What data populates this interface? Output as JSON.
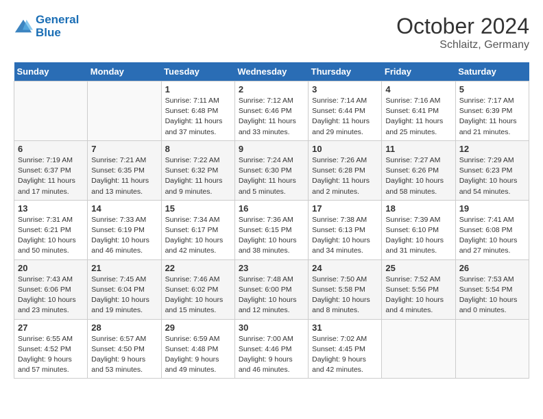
{
  "header": {
    "logo_line1": "General",
    "logo_line2": "Blue",
    "month_title": "October 2024",
    "location": "Schlaitz, Germany"
  },
  "days_of_week": [
    "Sunday",
    "Monday",
    "Tuesday",
    "Wednesday",
    "Thursday",
    "Friday",
    "Saturday"
  ],
  "weeks": [
    [
      {
        "day": "",
        "info": ""
      },
      {
        "day": "",
        "info": ""
      },
      {
        "day": "1",
        "info": "Sunrise: 7:11 AM\nSunset: 6:48 PM\nDaylight: 11 hours\nand 37 minutes."
      },
      {
        "day": "2",
        "info": "Sunrise: 7:12 AM\nSunset: 6:46 PM\nDaylight: 11 hours\nand 33 minutes."
      },
      {
        "day": "3",
        "info": "Sunrise: 7:14 AM\nSunset: 6:44 PM\nDaylight: 11 hours\nand 29 minutes."
      },
      {
        "day": "4",
        "info": "Sunrise: 7:16 AM\nSunset: 6:41 PM\nDaylight: 11 hours\nand 25 minutes."
      },
      {
        "day": "5",
        "info": "Sunrise: 7:17 AM\nSunset: 6:39 PM\nDaylight: 11 hours\nand 21 minutes."
      }
    ],
    [
      {
        "day": "6",
        "info": "Sunrise: 7:19 AM\nSunset: 6:37 PM\nDaylight: 11 hours\nand 17 minutes."
      },
      {
        "day": "7",
        "info": "Sunrise: 7:21 AM\nSunset: 6:35 PM\nDaylight: 11 hours\nand 13 minutes."
      },
      {
        "day": "8",
        "info": "Sunrise: 7:22 AM\nSunset: 6:32 PM\nDaylight: 11 hours\nand 9 minutes."
      },
      {
        "day": "9",
        "info": "Sunrise: 7:24 AM\nSunset: 6:30 PM\nDaylight: 11 hours\nand 5 minutes."
      },
      {
        "day": "10",
        "info": "Sunrise: 7:26 AM\nSunset: 6:28 PM\nDaylight: 11 hours\nand 2 minutes."
      },
      {
        "day": "11",
        "info": "Sunrise: 7:27 AM\nSunset: 6:26 PM\nDaylight: 10 hours\nand 58 minutes."
      },
      {
        "day": "12",
        "info": "Sunrise: 7:29 AM\nSunset: 6:23 PM\nDaylight: 10 hours\nand 54 minutes."
      }
    ],
    [
      {
        "day": "13",
        "info": "Sunrise: 7:31 AM\nSunset: 6:21 PM\nDaylight: 10 hours\nand 50 minutes."
      },
      {
        "day": "14",
        "info": "Sunrise: 7:33 AM\nSunset: 6:19 PM\nDaylight: 10 hours\nand 46 minutes."
      },
      {
        "day": "15",
        "info": "Sunrise: 7:34 AM\nSunset: 6:17 PM\nDaylight: 10 hours\nand 42 minutes."
      },
      {
        "day": "16",
        "info": "Sunrise: 7:36 AM\nSunset: 6:15 PM\nDaylight: 10 hours\nand 38 minutes."
      },
      {
        "day": "17",
        "info": "Sunrise: 7:38 AM\nSunset: 6:13 PM\nDaylight: 10 hours\nand 34 minutes."
      },
      {
        "day": "18",
        "info": "Sunrise: 7:39 AM\nSunset: 6:10 PM\nDaylight: 10 hours\nand 31 minutes."
      },
      {
        "day": "19",
        "info": "Sunrise: 7:41 AM\nSunset: 6:08 PM\nDaylight: 10 hours\nand 27 minutes."
      }
    ],
    [
      {
        "day": "20",
        "info": "Sunrise: 7:43 AM\nSunset: 6:06 PM\nDaylight: 10 hours\nand 23 minutes."
      },
      {
        "day": "21",
        "info": "Sunrise: 7:45 AM\nSunset: 6:04 PM\nDaylight: 10 hours\nand 19 minutes."
      },
      {
        "day": "22",
        "info": "Sunrise: 7:46 AM\nSunset: 6:02 PM\nDaylight: 10 hours\nand 15 minutes."
      },
      {
        "day": "23",
        "info": "Sunrise: 7:48 AM\nSunset: 6:00 PM\nDaylight: 10 hours\nand 12 minutes."
      },
      {
        "day": "24",
        "info": "Sunrise: 7:50 AM\nSunset: 5:58 PM\nDaylight: 10 hours\nand 8 minutes."
      },
      {
        "day": "25",
        "info": "Sunrise: 7:52 AM\nSunset: 5:56 PM\nDaylight: 10 hours\nand 4 minutes."
      },
      {
        "day": "26",
        "info": "Sunrise: 7:53 AM\nSunset: 5:54 PM\nDaylight: 10 hours\nand 0 minutes."
      }
    ],
    [
      {
        "day": "27",
        "info": "Sunrise: 6:55 AM\nSunset: 4:52 PM\nDaylight: 9 hours\nand 57 minutes."
      },
      {
        "day": "28",
        "info": "Sunrise: 6:57 AM\nSunset: 4:50 PM\nDaylight: 9 hours\nand 53 minutes."
      },
      {
        "day": "29",
        "info": "Sunrise: 6:59 AM\nSunset: 4:48 PM\nDaylight: 9 hours\nand 49 minutes."
      },
      {
        "day": "30",
        "info": "Sunrise: 7:00 AM\nSunset: 4:46 PM\nDaylight: 9 hours\nand 46 minutes."
      },
      {
        "day": "31",
        "info": "Sunrise: 7:02 AM\nSunset: 4:45 PM\nDaylight: 9 hours\nand 42 minutes."
      },
      {
        "day": "",
        "info": ""
      },
      {
        "day": "",
        "info": ""
      }
    ]
  ]
}
